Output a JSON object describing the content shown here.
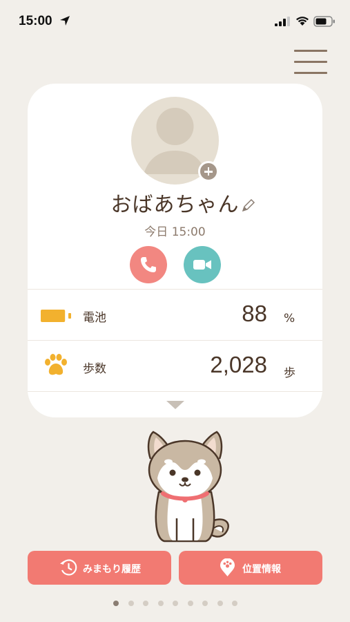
{
  "status_bar": {
    "time": "15:00",
    "icons": [
      "location-arrow-icon",
      "cellular-signal-icon",
      "wifi-icon",
      "battery-icon"
    ]
  },
  "header": {
    "menu_icon": "hamburger-menu-icon"
  },
  "profile": {
    "name": "おばあちゃん",
    "last_updated": "今日 15:00",
    "avatar_icon": "default-avatar-icon",
    "add_photo_icon": "add-circle-icon",
    "edit_icon": "pencil-icon"
  },
  "contact_actions": [
    {
      "icon": "phone-icon",
      "color": "#f28781"
    },
    {
      "icon": "video-camera-icon",
      "color": "#68c2bf"
    }
  ],
  "stats": {
    "battery": {
      "label": "電池",
      "value": "88",
      "unit": "%",
      "level": 0.88,
      "icon": "battery-icon",
      "color": "#f2b12e"
    },
    "steps": {
      "label": "歩数",
      "value": "2,028",
      "unit": "歩",
      "icon": "paw-icon",
      "color": "#f2b12e"
    }
  },
  "expand_icon": "chevron-down-icon",
  "mascot": "shiba-dog-illustration",
  "actions": {
    "history": {
      "label": "みまもり履歴",
      "icon": "history-clock-icon"
    },
    "location": {
      "label": "位置情報",
      "icon": "map-pin-icon"
    }
  },
  "pagination": {
    "total": 9,
    "current": 1
  },
  "colors": {
    "background": "#f2efea",
    "accent": "#f27a72",
    "text": "#4a3628"
  }
}
